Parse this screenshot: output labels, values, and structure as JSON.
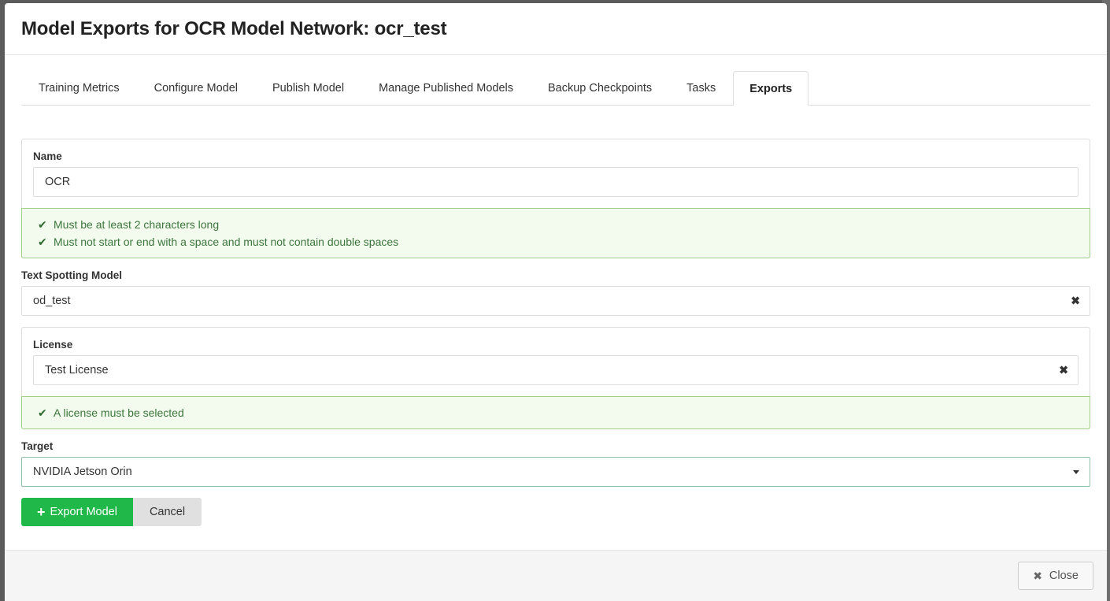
{
  "modal": {
    "title": "Model Exports for OCR Model Network: ocr_test"
  },
  "tabs": [
    {
      "label": "Training Metrics"
    },
    {
      "label": "Configure Model"
    },
    {
      "label": "Publish Model"
    },
    {
      "label": "Manage Published Models"
    },
    {
      "label": "Backup Checkpoints"
    },
    {
      "label": "Tasks"
    },
    {
      "label": "Exports",
      "active": true
    }
  ],
  "form": {
    "name": {
      "label": "Name",
      "value": "OCR",
      "rules": [
        "Must be at least 2 characters long",
        "Must not start or end with a space and must not contain double spaces"
      ]
    },
    "text_spotting": {
      "label": "Text Spotting Model",
      "value": "od_test"
    },
    "license": {
      "label": "License",
      "value": "Test License",
      "rules": [
        "A license must be selected"
      ]
    },
    "target": {
      "label": "Target",
      "value": "NVIDIA Jetson Orin"
    },
    "export_button": "Export Model",
    "cancel_button": "Cancel"
  },
  "footer": {
    "close_button": "Close"
  },
  "colors": {
    "primary_green": "#21b84a",
    "validation_bg": "#f3faee",
    "validation_border": "#9ccf85",
    "validation_text": "#3c763d"
  },
  "icons": {
    "check": "check-icon",
    "clear": "clear-x-icon",
    "plus": "plus-icon",
    "close": "close-x-icon",
    "caret": "caret-down-icon"
  }
}
